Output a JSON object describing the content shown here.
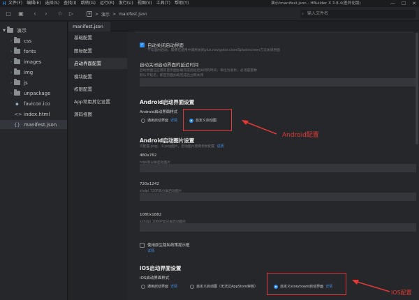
{
  "menubar": {
    "items": [
      "文件(F)",
      "编辑(E)",
      "选择(S)",
      "查找(I)",
      "跳转(G)",
      "运行(R)",
      "发行(U)",
      "视图(V)",
      "工具(T)",
      "帮助(Y)"
    ],
    "window_title": "演示/manifest.json - HBuilder X 3.8.4(差异化版)",
    "controls": [
      "—",
      "☐",
      "✕"
    ]
  },
  "toolbar": {
    "breadcrumb_root": "演示",
    "breadcrumb_sep": ">",
    "breadcrumb_file": "manifest.json",
    "search_placeholder": "输入文件名"
  },
  "tree": {
    "root": "演示",
    "folders": [
      "css",
      "fonts",
      "images",
      "img",
      "js",
      "unpackage"
    ],
    "files": [
      "favicon.ico",
      "index.html",
      "manifest.json"
    ]
  },
  "editor": {
    "tab_label": "manifest.json"
  },
  "nav": {
    "items": [
      "基础配置",
      "图标配置",
      "启动界面配置",
      "模块配置",
      "权限配置",
      "App常用其它设置",
      "源码视图"
    ],
    "active_index": 2
  },
  "content": {
    "auto_close_label": "自动关闭启动界面",
    "auto_close_hint": "不勾选时启动，需要在适用中调用关闭plus.navigator.closeSplashscreen方法关闭界面",
    "delay_label": "自动关闭启动界面的延迟时间",
    "delay_hint_1": "启动界面在应用的首页面加载完成后延迟关闭的时间，单位为毫秒，必须是整数",
    "delay_hint_2": "默认不延迟，即首页面加载完成后立即关闭",
    "android_section": "Android启动界面设置",
    "android_style_label": "Android启动界面样式",
    "android_opt_general": "通用启动界面",
    "android_opt_general_link": "详情",
    "android_opt_custom": "自定义启动图",
    "android_img_section": "Android启动图片设置",
    "android_img_hint": "可配置.png、.9.png图片，启动图片需要参数配置",
    "android_img_link": "说明",
    "sizes": [
      {
        "label": "480x762",
        "hint": "hdpi高分屏启动图片"
      },
      {
        "label": "720x1242",
        "hint": "xhdpi 720P高分屏启动图片"
      },
      {
        "label": "1080x1882",
        "hint": "xxhdpi 1080P高分屏启动图片"
      }
    ],
    "native_loading_label": "使用原生隐私政策提示框",
    "native_loading_link": "详情",
    "ios_section": "iOS启动界面设置",
    "ios_style_label": "iOS启动界面样式",
    "ios_opt_general": "通用启动界面",
    "ios_opt_general_link": "详情",
    "ios_opt_custom_img": "自定义启动图（无法过AppStore审核）",
    "ios_opt_storyboard": "自定义storyboard启动界面",
    "ios_opt_storyboard_link": "详情"
  },
  "annotations": {
    "android": "Android配置",
    "ios": "iOS配置",
    "color": "#e53935"
  },
  "colors": {
    "accent": "#2d8cf0",
    "link": "#3f8fe0"
  },
  "icons": {
    "logo": "hbuilder-logo-icon",
    "checkbox_checked": "checkmark-icon"
  }
}
